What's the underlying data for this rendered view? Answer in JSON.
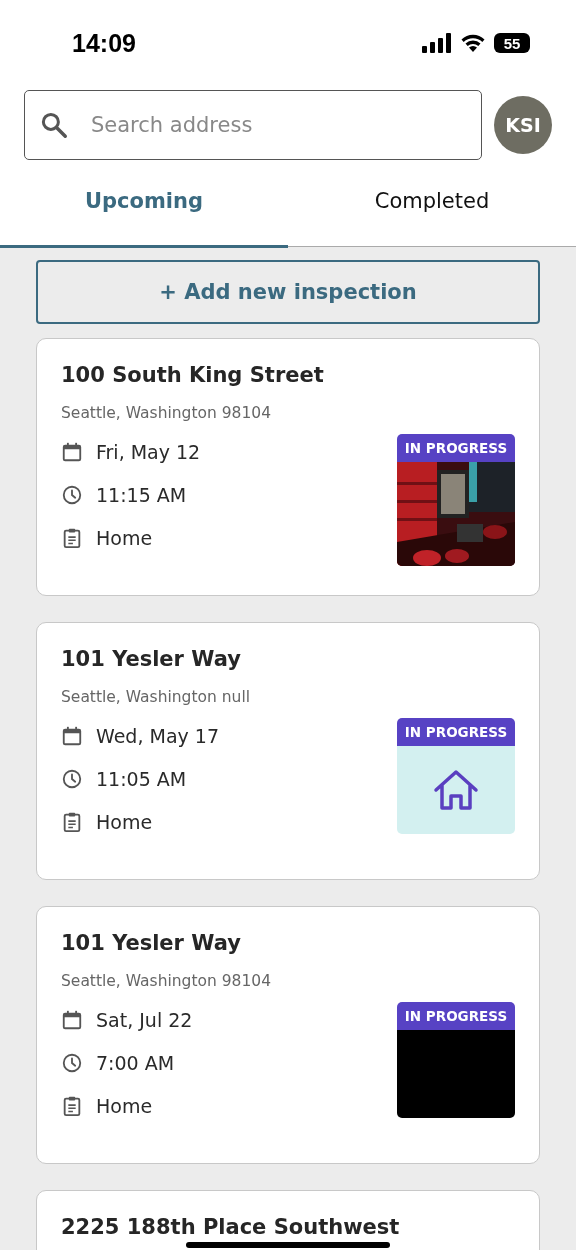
{
  "status_bar": {
    "time": "14:09",
    "battery": "55"
  },
  "search": {
    "placeholder": "Search address"
  },
  "avatar": {
    "initials": "KSI"
  },
  "tabs": [
    {
      "label": "Upcoming",
      "selected": true
    },
    {
      "label": "Completed",
      "selected": false
    }
  ],
  "add_button": {
    "label": "+ Add new inspection"
  },
  "inspections": [
    {
      "street": "100 South King Street",
      "city": "Seattle, Washington 98104",
      "date": "Fri, May 12",
      "time": "11:15 AM",
      "type": "Home",
      "status": "IN PROGRESS"
    },
    {
      "street": "101 Yesler Way",
      "city": "Seattle, Washington null",
      "date": "Wed, May 17",
      "time": "11:05 AM",
      "type": "Home",
      "status": "IN PROGRESS",
      "thumb": {
        "kind": "placeholder"
      }
    },
    {
      "street": "101 Yesler Way",
      "city": "Seattle, Washington 98104",
      "date": "Sat, Jul 22",
      "time": "7:00 AM",
      "type": "Home",
      "status": "IN PROGRESS",
      "thumb": {
        "kind": "blank"
      }
    },
    {
      "street": "2225 188th Place Southwest"
    }
  ]
}
